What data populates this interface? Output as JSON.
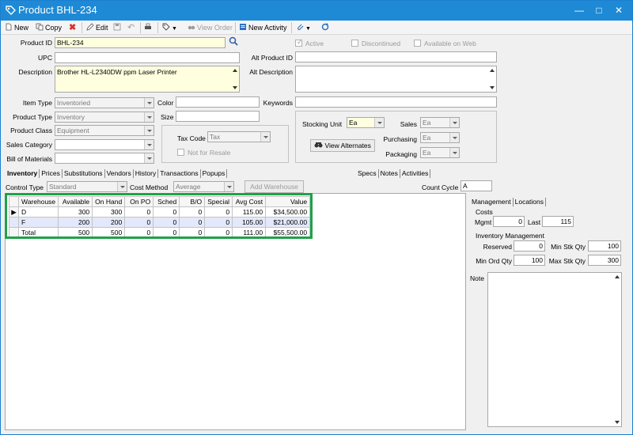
{
  "window": {
    "title": "Product BHL-234"
  },
  "toolbar": {
    "new": "New",
    "copy": "Copy",
    "edit": "Edit",
    "view_order": "View Order",
    "new_activity": "New Activity"
  },
  "form": {
    "product_id": {
      "label": "Product ID",
      "value": "BHL-234"
    },
    "upc": {
      "label": "UPC",
      "value": ""
    },
    "description": {
      "label": "Description",
      "value": "Brother HL-L2340DW ppm Laser Printer"
    },
    "item_type": {
      "label": "Item Type",
      "value": "Inventoried"
    },
    "product_type": {
      "label": "Product Type",
      "value": "Inventory"
    },
    "product_class": {
      "label": "Product Class",
      "value": "Equipment"
    },
    "sales_category": {
      "label": "Sales Category",
      "value": ""
    },
    "bill_of_materials": {
      "label": "Bill of Materials",
      "value": ""
    },
    "color": {
      "label": "Color",
      "value": ""
    },
    "size": {
      "label": "Size",
      "value": ""
    },
    "keywords": {
      "label": "Keywords",
      "value": ""
    },
    "alt_product_id": {
      "label": "Alt Product ID",
      "value": ""
    },
    "alt_description": {
      "label": "Alt Description",
      "value": ""
    },
    "active": "Active",
    "discontinued": "Discontinued",
    "available_on_web": "Available on Web",
    "tax_code": {
      "label": "Tax Code",
      "value": "Tax"
    },
    "not_for_resale": "Not for Resale",
    "stocking_unit": {
      "label": "Stocking Unit",
      "value": "Ea"
    },
    "sales": {
      "label": "Sales",
      "value": "Ea"
    },
    "purchasing": {
      "label": "Purchasing",
      "value": "Ea"
    },
    "packaging": {
      "label": "Packaging",
      "value": "Ea"
    },
    "view_alternates": "View Alternates"
  },
  "tabs_left": [
    "Inventory",
    "Prices",
    "Substitutions",
    "Vendors",
    "History",
    "Transactions",
    "Popups"
  ],
  "tabs_right": [
    "Specs",
    "Notes",
    "Activities"
  ],
  "inventory": {
    "control_type": {
      "label": "Control Type",
      "value": "Standard"
    },
    "cost_method": {
      "label": "Cost Method",
      "value": "Average"
    },
    "add_warehouse": "Add Warehouse",
    "count_cycle": {
      "label": "Count Cycle",
      "value": "A"
    },
    "columns": [
      "Warehouse",
      "Available",
      "On Hand",
      "On PO",
      "Sched",
      "B/O",
      "Special",
      "Avg Cost",
      "Value"
    ],
    "rows": [
      [
        "D",
        "300",
        "300",
        "0",
        "0",
        "0",
        "0",
        "115.00",
        "$34,500.00"
      ],
      [
        "F",
        "200",
        "200",
        "0",
        "0",
        "0",
        "0",
        "105.00",
        "$21,000.00"
      ],
      [
        "Total",
        "500",
        "500",
        "0",
        "0",
        "0",
        "0",
        "111.00",
        "$55,500.00"
      ]
    ]
  },
  "right_panel": {
    "tabs": [
      "Management",
      "Locations"
    ],
    "costs": "Costs",
    "mgmt": {
      "label": "Mgmt",
      "value": "0"
    },
    "last": {
      "label": "Last",
      "value": "115"
    },
    "inventory_management": "Inventory Management",
    "reserved": {
      "label": "Reserved",
      "value": "0"
    },
    "min_stk_qty": {
      "label": "Min Stk Qty",
      "value": "100"
    },
    "min_ord_qty": {
      "label": "Min Ord Qty",
      "value": "100"
    },
    "max_stk_qty": {
      "label": "Max Stk Qty",
      "value": "300"
    },
    "note": "Note"
  }
}
